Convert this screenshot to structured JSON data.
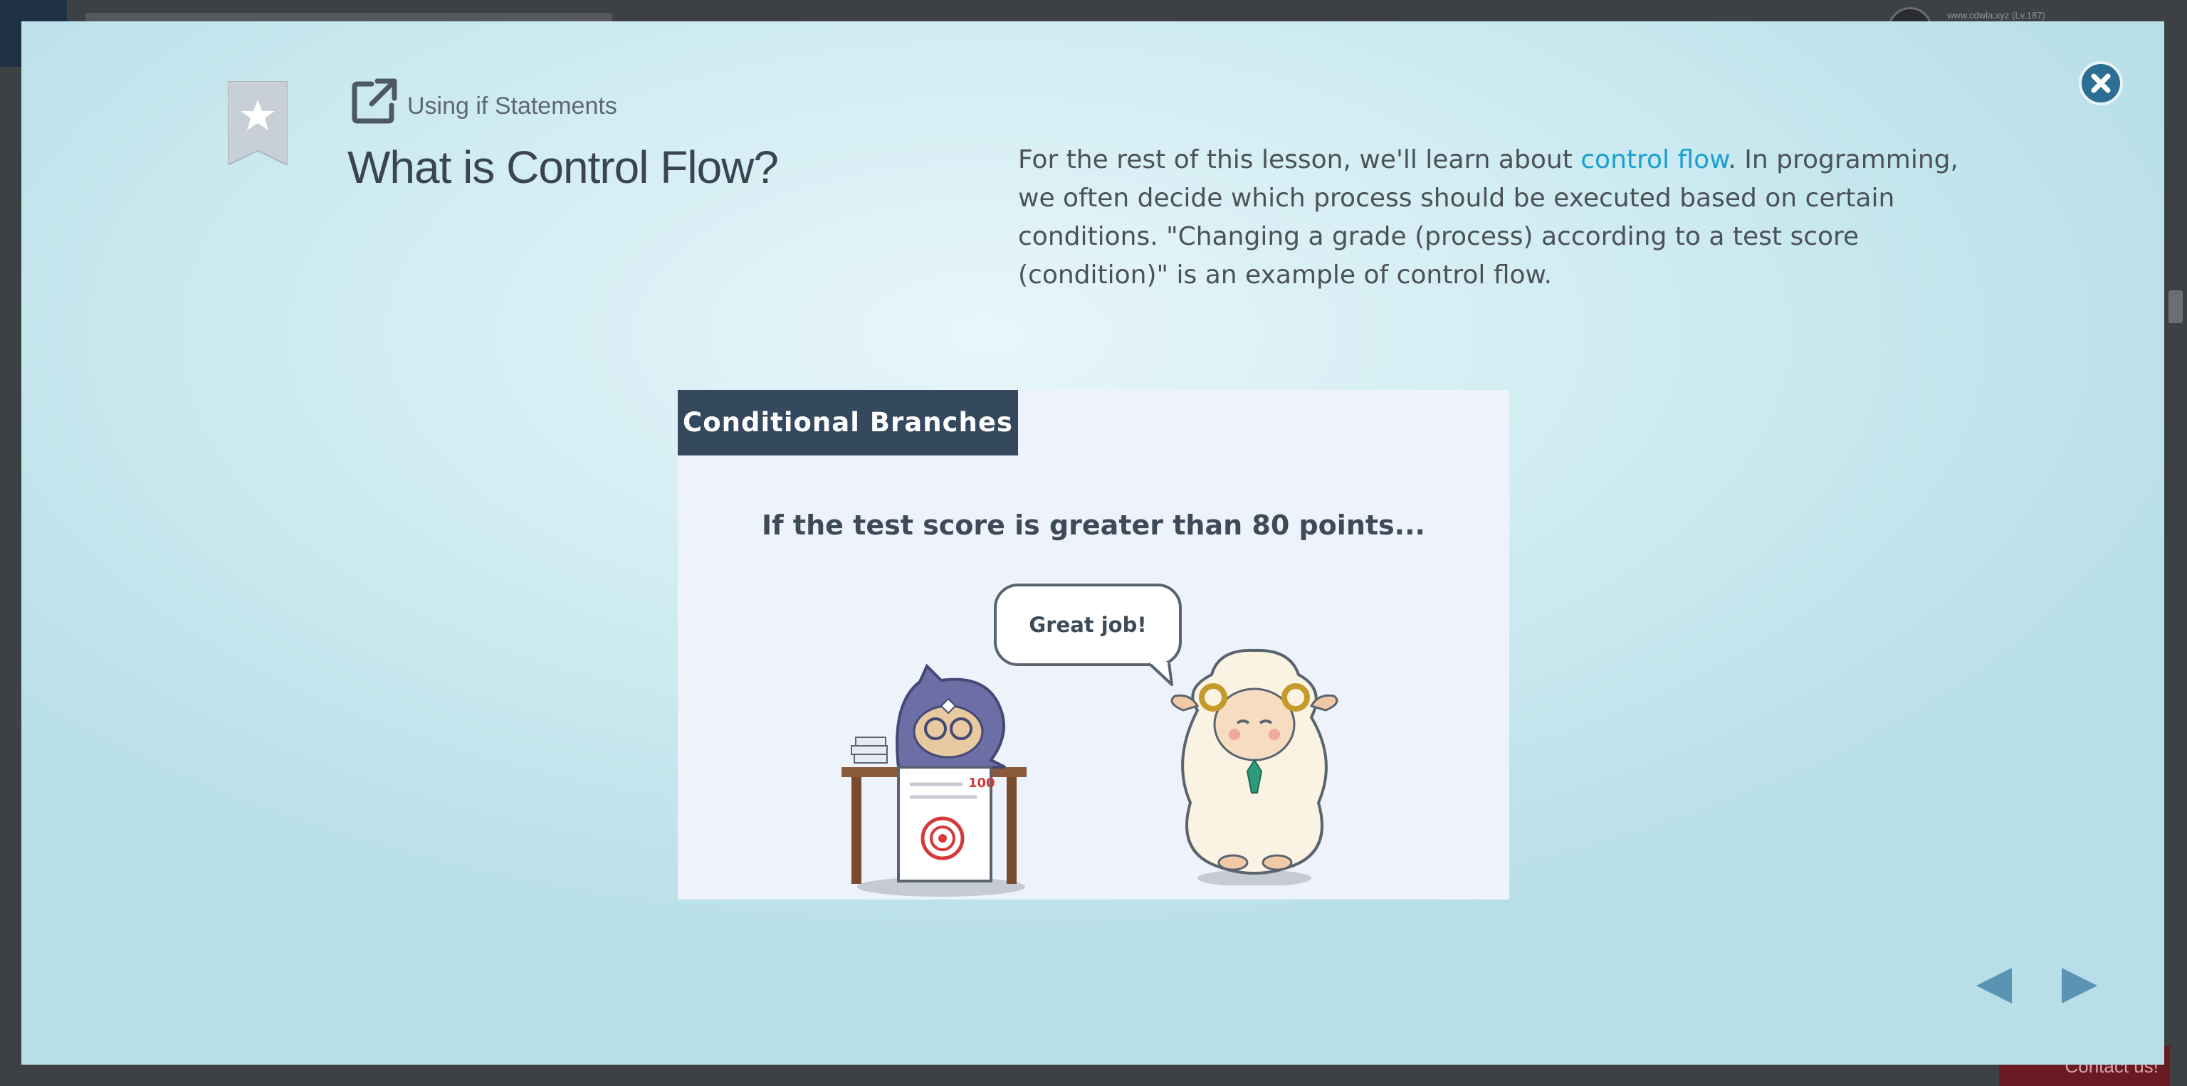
{
  "background": {
    "user_text": "www.cdwla.xyz (Lv.187)",
    "contact_label": "Contact us!"
  },
  "lesson": {
    "course_name": "Using if Statements",
    "title": "What is Control Flow?",
    "description_before": "For the rest of this lesson, we'll learn about ",
    "description_link": "control flow",
    "description_after": ". In programming, we often decide which process should be executed based on certain conditions. \"Changing a grade (process) according to a test score (condition)\" is an example of control flow."
  },
  "illustration": {
    "header": "Conditional Branches",
    "caption": "If the test score is greater than 80 points...",
    "speech": "Great job!",
    "score_mark": "100"
  },
  "colors": {
    "accent_link": "#1a9fcf",
    "header_bg": "#34495e",
    "close_bg": "#2c6e94",
    "nav_arrow": "#5b93b5"
  },
  "icons": {
    "close": "close-icon",
    "bookmark": "bookmark-star-icon",
    "external": "external-link-icon",
    "prev": "triangle-left-icon",
    "next": "triangle-right-icon"
  }
}
